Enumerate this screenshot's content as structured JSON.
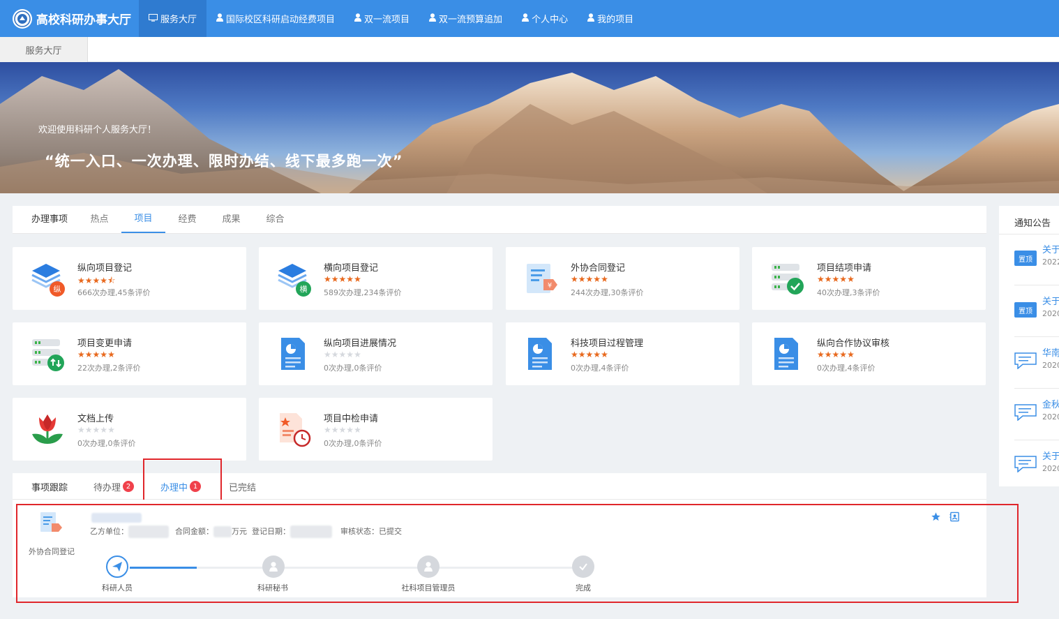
{
  "brand": {
    "title": "高校科研办事大厅"
  },
  "nav": [
    {
      "label": "服务大厅",
      "icon": "monitor-icon",
      "active": true
    },
    {
      "label": "国际校区科研启动经费项目",
      "icon": "user-icon"
    },
    {
      "label": "双一流项目",
      "icon": "user-icon"
    },
    {
      "label": "双一流预算追加",
      "icon": "user-icon"
    },
    {
      "label": "个人中心",
      "icon": "user-icon"
    },
    {
      "label": "我的项目",
      "icon": "user-icon"
    }
  ],
  "breadcrumb": {
    "tab": "服务大厅"
  },
  "hero": {
    "welcome": "欢迎使用科研个人服务大厅！",
    "slogan": "“统一入口、一次办理、限时办结、线下最多跑一次”"
  },
  "services": {
    "title": "办理事项",
    "tabs": [
      "热点",
      "项目",
      "经费",
      "成果",
      "综合"
    ],
    "active_tab": "项目",
    "cards": [
      {
        "name": "纵向项目登记",
        "rating": 4.5,
        "stat": "666次办理,45条评价",
        "icon": "vertical-project-icon"
      },
      {
        "name": "横向项目登记",
        "rating": 5,
        "stat": "589次办理,234条评价",
        "icon": "horizontal-project-icon"
      },
      {
        "name": "外协合同登记",
        "rating": 5,
        "stat": "244次办理,30条评价",
        "icon": "contract-icon"
      },
      {
        "name": "项目结项申请",
        "rating": 5,
        "stat": "40次办理,3条评价",
        "icon": "project-close-icon"
      },
      {
        "name": "项目变更申请",
        "rating": 5,
        "stat": "22次办理,2条评价",
        "icon": "project-change-icon"
      },
      {
        "name": "纵向项目进展情况",
        "rating": 0,
        "stat": "0次办理,0条评价",
        "icon": "report-icon"
      },
      {
        "name": "科技项目过程管理",
        "rating": 5,
        "stat": "0次办理,4条评价",
        "icon": "report-icon"
      },
      {
        "name": "纵向合作协议审核",
        "rating": 5,
        "stat": "0次办理,4条评价",
        "icon": "report-icon"
      },
      {
        "name": "文档上传",
        "rating": 0,
        "stat": "0次办理,0条评价",
        "icon": "tulip-icon"
      },
      {
        "name": "项目中检申请",
        "rating": 0,
        "stat": "0次办理,0条评价",
        "icon": "midterm-check-icon"
      }
    ]
  },
  "tracking": {
    "title": "事项跟踪",
    "tabs": [
      {
        "label": "待办理",
        "badge": "2"
      },
      {
        "label": "办理中",
        "badge": "1"
      },
      {
        "label": "已完结",
        "badge": ""
      }
    ],
    "active_tab": "办理中",
    "item": {
      "type_label": "外协合同登记",
      "party_label": "乙方单位：",
      "amount_label": "合同金额：",
      "amount_unit": "万元",
      "date_label": "登记日期：",
      "status_label": "审核状态：已提交",
      "steps": [
        "科研人员",
        "科研秘书",
        "社科项目管理员",
        "完成"
      ],
      "current_step": 1
    }
  },
  "notice": {
    "title": "通知公告",
    "items": [
      {
        "tag": "置顶",
        "text": "关于",
        "year": "2022"
      },
      {
        "tag": "置顶",
        "text": "关于",
        "year": "2020"
      },
      {
        "tag": "",
        "text": "华南",
        "year": "2020"
      },
      {
        "tag": "",
        "text": "金秋",
        "year": "2020"
      },
      {
        "tag": "",
        "text": "关于",
        "year": "2020"
      }
    ]
  },
  "colors": {
    "primary": "#3a8ee6",
    "star": "#e8691e",
    "highlight": "#e0262b",
    "badge": "#f0414b"
  }
}
